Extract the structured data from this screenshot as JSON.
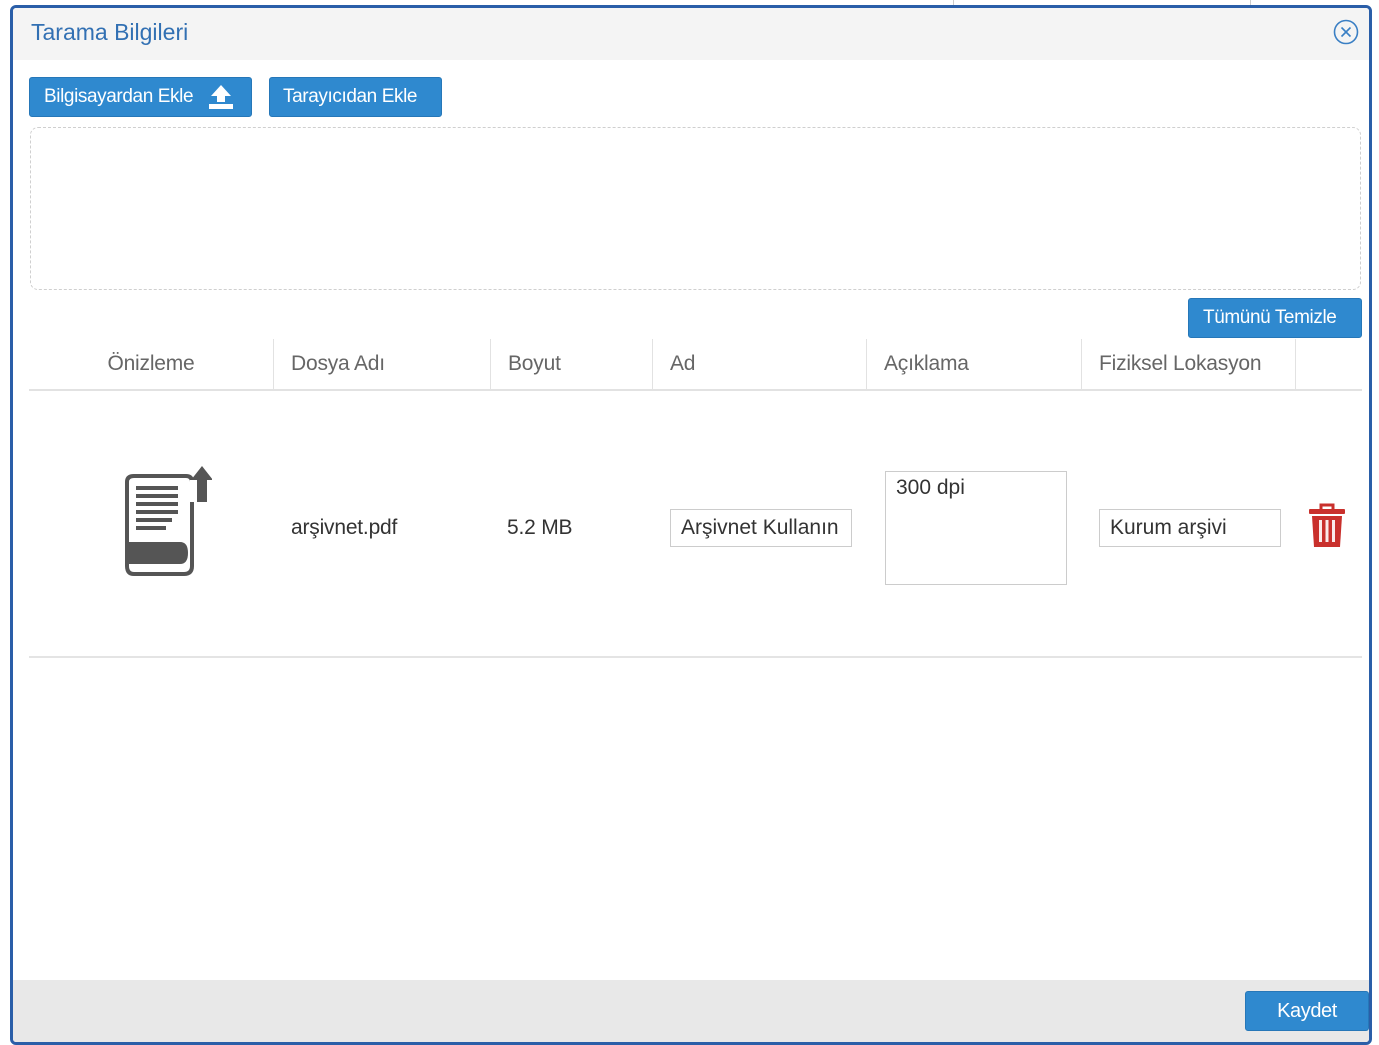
{
  "dialog": {
    "title": "Tarama Bilgileri",
    "accent_color": "#2f89cf",
    "close_icon": "close-circle-icon"
  },
  "toolbar": {
    "upload_label": "Bilgisayardan Ekle",
    "upload_icon": "upload-icon",
    "scanner_label": "Tarayıcıdan Ekle",
    "clear_all_label": "Tümünü Temizle"
  },
  "table": {
    "columns": [
      "Önizleme",
      "Dosya Adı",
      "Boyut",
      "Ad",
      "Açıklama",
      "Fiziksel Lokasyon"
    ],
    "rows": [
      {
        "preview_icon": "pdf-document-upload-icon",
        "file_name": "arşivnet.pdf",
        "size": "5.2 MB",
        "name": "Arşivnet Kullanın",
        "description": "300 dpi",
        "physical_location": "Kurum arşivi",
        "delete_icon": "trash-icon",
        "delete_color": "#c9302c"
      }
    ]
  },
  "footer": {
    "save_label": "Kaydet"
  }
}
